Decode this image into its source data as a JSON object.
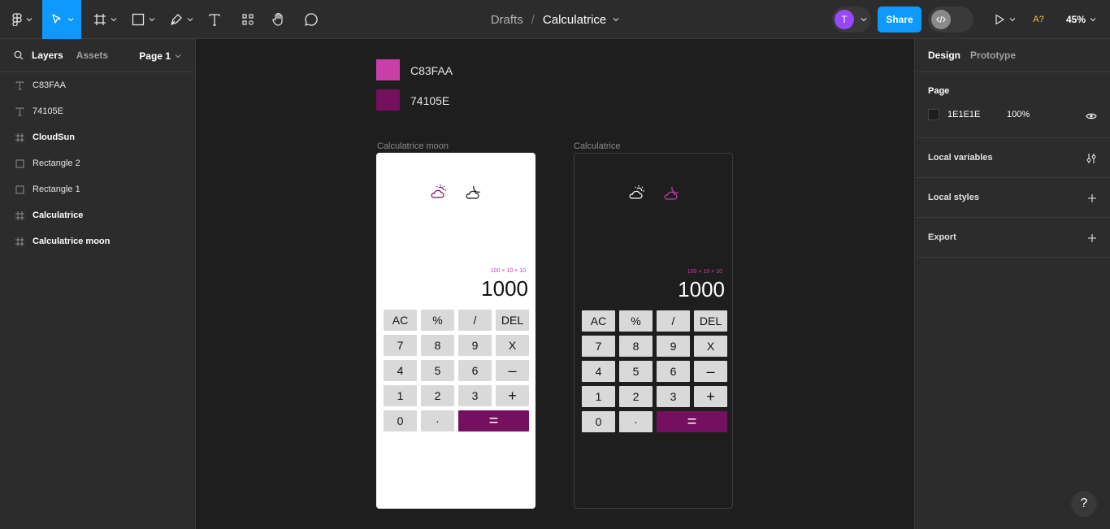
{
  "toolbar": {
    "breadcrumb_drafts": "Drafts",
    "breadcrumb_sep": "/",
    "file_title": "Calculatrice",
    "avatar_initial": "T",
    "share_label": "Share",
    "ai_label": "A?",
    "zoom_label": "45%",
    "colors": {
      "accent": "#0d99ff",
      "avatar": "#9747ff"
    }
  },
  "left_panel": {
    "tab_layers": "Layers",
    "tab_assets": "Assets",
    "page_selector": "Page 1",
    "layers": [
      {
        "icon": "text-icon",
        "label": "C83FAA"
      },
      {
        "icon": "text-icon",
        "label": "74105E"
      },
      {
        "icon": "frame-icon",
        "label": "CloudSun"
      },
      {
        "icon": "rectangle-icon",
        "label": "Rectangle 2"
      },
      {
        "icon": "rectangle-icon",
        "label": "Rectangle 1"
      },
      {
        "icon": "frame-icon",
        "label": "Calculatrice"
      },
      {
        "icon": "frame-icon",
        "label": "Calculatrice moon"
      }
    ]
  },
  "canvas": {
    "swatches": [
      {
        "label": "C83FAA",
        "color": "#c83faa"
      },
      {
        "label": "74105E",
        "color": "#74105e"
      }
    ],
    "frames": [
      {
        "label": "Calculatrice moon",
        "theme": "light",
        "expression": "100 × 10 × 10",
        "result": "1000"
      },
      {
        "label": "Calculatrice",
        "theme": "dark",
        "expression": "100 × 10 × 10",
        "result": "1000"
      }
    ],
    "keys": [
      "AC",
      "%",
      "/",
      "DEL",
      "7",
      "8",
      "9",
      "X",
      "4",
      "5",
      "6",
      "–",
      "1",
      "2",
      "3",
      "+",
      "0",
      "·",
      "="
    ]
  },
  "right_panel": {
    "tab_design": "Design",
    "tab_prototype": "Prototype",
    "page_title": "Page",
    "page_color": "1E1E1E",
    "page_opacity": "100%",
    "local_variables": "Local variables",
    "local_styles": "Local styles",
    "export": "Export"
  },
  "help_label": "?"
}
